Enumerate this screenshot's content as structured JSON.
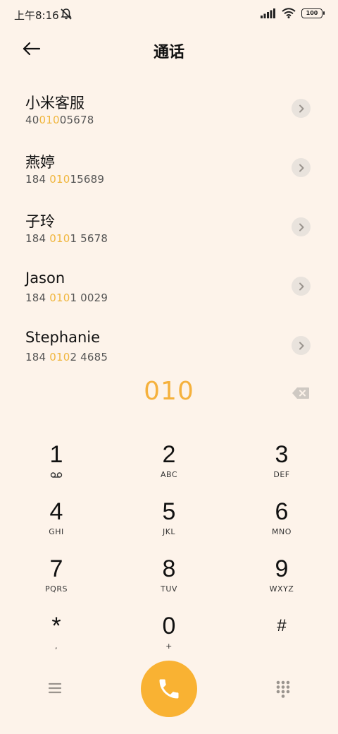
{
  "status_bar": {
    "time": "上午8:16",
    "battery": "100"
  },
  "header": {
    "title": "通话"
  },
  "results": [
    {
      "name": "小米客服",
      "number_before": "40",
      "number_match": "010",
      "number_after": "05678"
    },
    {
      "name": "燕婷",
      "number_before": "184 ",
      "number_match": "010",
      "number_after": "15689"
    },
    {
      "name": "子玲",
      "number_before": "184 ",
      "number_match": "010",
      "number_after": "1 5678"
    },
    {
      "name": "Jason",
      "number_before": "184 ",
      "number_match": "010",
      "number_after": "1 0029"
    },
    {
      "name": "Stephanie",
      "number_before": "184 ",
      "number_match": "010",
      "number_after": "2 4685"
    }
  ],
  "dialer": {
    "typed": "010"
  },
  "keypad": [
    {
      "digit": "1",
      "letters": "",
      "icon": "voicemail-icon"
    },
    {
      "digit": "2",
      "letters": "ABC"
    },
    {
      "digit": "3",
      "letters": "DEF"
    },
    {
      "digit": "4",
      "letters": "GHI"
    },
    {
      "digit": "5",
      "letters": "JKL"
    },
    {
      "digit": "6",
      "letters": "MNO"
    },
    {
      "digit": "7",
      "letters": "PQRS"
    },
    {
      "digit": "8",
      "letters": "TUV"
    },
    {
      "digit": "9",
      "letters": "WXYZ"
    },
    {
      "digit": "*",
      "letters": ","
    },
    {
      "digit": "0",
      "letters": "+"
    },
    {
      "digit": "#",
      "letters": ""
    }
  ],
  "colors": {
    "background": "#fdf3ea",
    "accent": "#f5b13d",
    "call_button": "#f9b233"
  }
}
